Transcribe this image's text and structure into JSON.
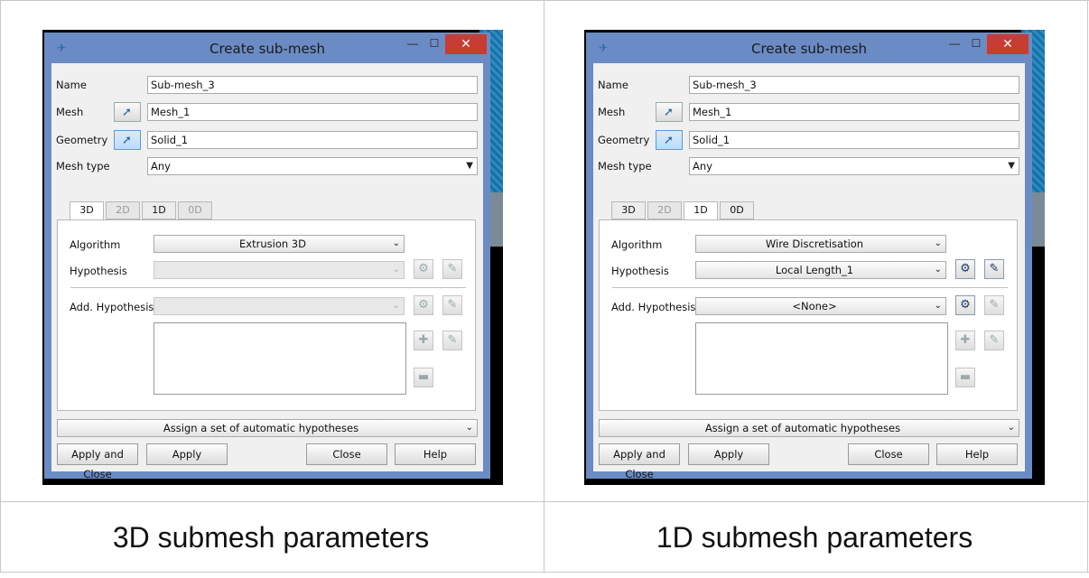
{
  "panels": [
    {
      "caption": "3D submesh parameters",
      "dialog": {
        "title": "Create sub-mesh",
        "name_label": "Name",
        "name_value": "Sub-mesh_3",
        "mesh_label": "Mesh",
        "mesh_value": "Mesh_1",
        "geometry_label": "Geometry",
        "geometry_value": "Solid_1",
        "mesh_type_label": "Mesh type",
        "mesh_type_value": "Any",
        "tabs": [
          "3D",
          "2D",
          "1D",
          "0D"
        ],
        "active_tab": "3D",
        "algorithm_label": "Algorithm",
        "algorithm_value": "Extrusion 3D",
        "hypothesis_label": "Hypothesis",
        "hypothesis_value": "",
        "add_hypothesis_label": "Add. Hypothesis",
        "add_hypothesis_value": "",
        "auto_hypotheses": "Assign a set of automatic hypotheses",
        "buttons": {
          "apply_close": "Apply and Close",
          "apply": "Apply",
          "close": "Close",
          "help": "Help"
        }
      }
    },
    {
      "caption": "1D submesh parameters",
      "dialog": {
        "title": "Create sub-mesh",
        "name_label": "Name",
        "name_value": "Sub-mesh_3",
        "mesh_label": "Mesh",
        "mesh_value": "Mesh_1",
        "geometry_label": "Geometry",
        "geometry_value": "Solid_1",
        "mesh_type_label": "Mesh type",
        "mesh_type_value": "Any",
        "tabs": [
          "3D",
          "2D",
          "1D",
          "0D"
        ],
        "active_tab": "1D",
        "algorithm_label": "Algorithm",
        "algorithm_value": "Wire Discretisation",
        "hypothesis_label": "Hypothesis",
        "hypothesis_value": "Local Length_1",
        "add_hypothesis_label": "Add. Hypothesis",
        "add_hypothesis_value": "<None>",
        "auto_hypotheses": "Assign a set of automatic hypotheses",
        "buttons": {
          "apply_close": "Apply and Close",
          "apply": "Apply",
          "close": "Close",
          "help": "Help"
        }
      }
    }
  ],
  "icons": {
    "app": "salome-icon",
    "select": "selection-arrow-icon",
    "edit_hyp": "edit-hypothesis-icon",
    "new_hyp": "create-hypothesis-icon",
    "add": "plus-icon",
    "remove": "minus-icon",
    "combo_arrow": "chevron-down-icon"
  },
  "colors": {
    "titlebar": "#6b8bc4",
    "close_button": "#c83c32",
    "selected_button": "#bcdcf4"
  }
}
